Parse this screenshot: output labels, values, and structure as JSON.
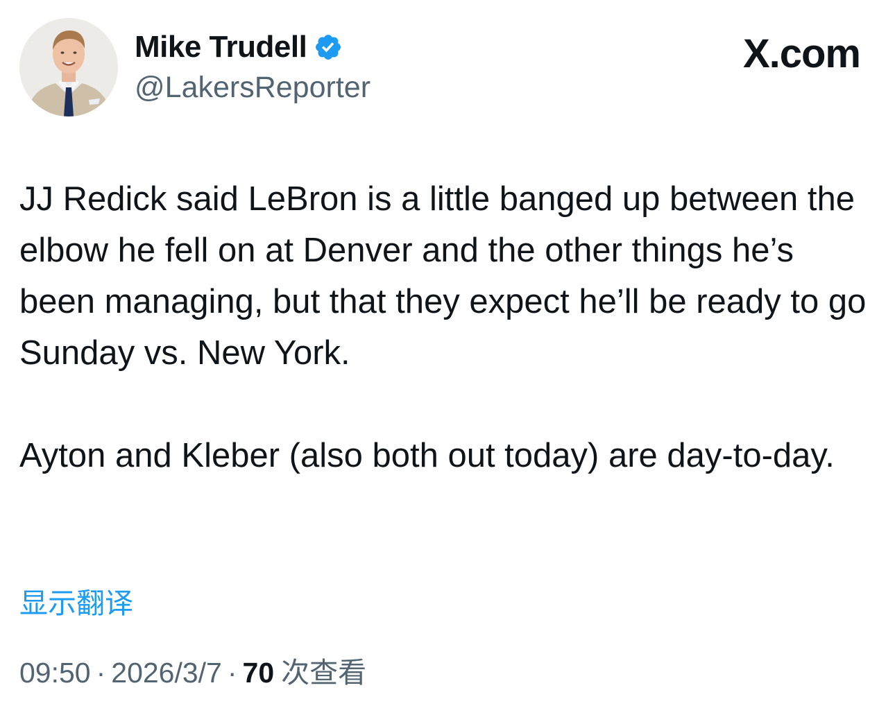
{
  "author": {
    "display_name": "Mike Trudell",
    "handle": "@LakersReporter",
    "verified_color": "#1d9bf0"
  },
  "site_logo": "X.com",
  "tweet": {
    "paragraphs": [
      "JJ Redick said LeBron is a little banged up between the elbow he fell on at Denver and the other things he’s been managing, but that they expect he’ll be ready to go Sunday vs. New York.",
      "Ayton and Kleber (also both out today) are day-to-day."
    ]
  },
  "translate_label": "显示翻译",
  "meta": {
    "time": "09:50",
    "separator": "·",
    "date": "2026/3/7",
    "views_count": "70",
    "views_label": "次查看"
  },
  "icons": {
    "verified": "verified-badge-icon",
    "avatar": "profile-photo"
  },
  "colors": {
    "text_primary": "#0f1419",
    "text_secondary": "#536471",
    "link": "#1d9bf0"
  }
}
